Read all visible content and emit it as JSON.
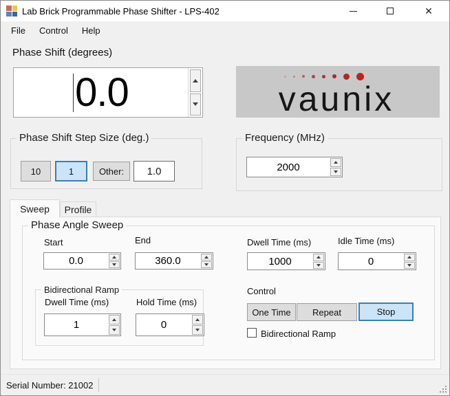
{
  "window": {
    "title": "Lab Brick Programmable Phase Shifter - LPS-402",
    "close_glyph": "✕"
  },
  "menu": {
    "items": [
      "File",
      "Control",
      "Help"
    ]
  },
  "phase_shift": {
    "label": "Phase Shift (degrees)",
    "value": "0.0"
  },
  "logo": {
    "text": "vaunix",
    "dots": [
      {
        "size": 3,
        "color": "#c4a49d"
      },
      {
        "size": 3,
        "color": "#ba8a82"
      },
      {
        "size": 4,
        "color": "#ac675f"
      },
      {
        "size": 5,
        "color": "#a14c45"
      },
      {
        "size": 5,
        "color": "#9b3b35"
      },
      {
        "size": 6,
        "color": "#a02e29"
      },
      {
        "size": 9,
        "color": "#b32420"
      },
      {
        "size": 11,
        "color": "#c1201a"
      }
    ]
  },
  "step_size": {
    "label": "Phase Shift Step Size (deg.)",
    "buttons": [
      {
        "label": "10",
        "selected": false
      },
      {
        "label": "1",
        "selected": true
      },
      {
        "label": "Other:",
        "selected": false
      }
    ],
    "other_value": "1.0"
  },
  "frequency": {
    "label": "Frequency (MHz)",
    "value": "2000"
  },
  "tabs": [
    {
      "label": "Sweep",
      "selected": true
    },
    {
      "label": "Profile",
      "selected": false
    }
  ],
  "sweep": {
    "group_label": "Phase Angle Sweep",
    "start": {
      "label": "Start",
      "value": "0.0"
    },
    "end": {
      "label": "End",
      "value": "360.0"
    },
    "dwell": {
      "label": "Dwell Time (ms)",
      "value": "1000"
    },
    "idle": {
      "label": "Idle Time (ms)",
      "value": "0"
    },
    "bidir_group": {
      "label": "Bidirectional Ramp",
      "dwell": {
        "label": "Dwell Time (ms)",
        "value": "1"
      },
      "hold": {
        "label": "Hold Time (ms)",
        "value": "0"
      }
    },
    "control": {
      "label": "Control",
      "buttons": [
        {
          "label": "One Time",
          "selected": false
        },
        {
          "label": "Repeat",
          "selected": false
        },
        {
          "label": "Stop",
          "selected": true
        }
      ],
      "checkbox": {
        "label": "Bidirectional Ramp",
        "checked": false
      }
    }
  },
  "status": {
    "text": "Serial Number: 21002"
  },
  "colors": {
    "selection_fill": "#cce4f7",
    "selection_border": "#3c7fb1",
    "logo_bg": "#c8c8c8",
    "logo_red": "#c1201a"
  }
}
